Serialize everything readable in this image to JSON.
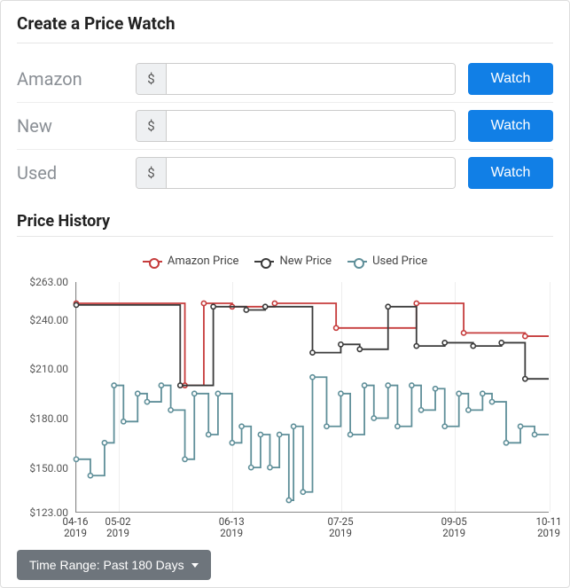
{
  "create_watch": {
    "title": "Create a Price Watch",
    "currency_symbol": "$",
    "rows": [
      {
        "label": "Amazon",
        "button": "Watch",
        "value": ""
      },
      {
        "label": "New",
        "button": "Watch",
        "value": ""
      },
      {
        "label": "Used",
        "button": "Watch",
        "value": ""
      }
    ]
  },
  "history": {
    "title": "Price History",
    "legend": {
      "amazon": "Amazon Price",
      "new": "New Price",
      "used": "Used Price"
    }
  },
  "timerange": {
    "label": "Time Range: Past 180 Days"
  },
  "chart_data": {
    "type": "line",
    "title": "Price History",
    "ylabel": "",
    "xlabel": "",
    "ylim": [
      123,
      263
    ],
    "y_ticks": [
      263.0,
      240.0,
      210.0,
      180.0,
      150.0,
      123.0
    ],
    "x_ticks": [
      {
        "t": 0.0,
        "label_top": "04-16",
        "label_bottom": "2019"
      },
      {
        "t": 0.09,
        "label_top": "05-02",
        "label_bottom": "2019"
      },
      {
        "t": 0.33,
        "label_top": "06-13",
        "label_bottom": "2019"
      },
      {
        "t": 0.56,
        "label_top": "07-25",
        "label_bottom": "2019"
      },
      {
        "t": 0.8,
        "label_top": "09-05",
        "label_bottom": "2019"
      },
      {
        "t": 1.0,
        "label_top": "10-11",
        "label_bottom": "2019"
      }
    ],
    "colors": {
      "amazon": "#c63c3c",
      "new": "#3b3b3b",
      "used": "#5f8f99"
    },
    "series": [
      {
        "name": "Amazon Price",
        "key": "amazon",
        "points": [
          [
            0.0,
            250
          ],
          [
            0.23,
            250
          ],
          [
            0.23,
            200
          ],
          [
            0.27,
            200
          ],
          [
            0.27,
            250
          ],
          [
            0.33,
            250
          ],
          [
            0.33,
            248
          ],
          [
            0.42,
            248
          ],
          [
            0.42,
            250
          ],
          [
            0.55,
            250
          ],
          [
            0.55,
            235
          ],
          [
            0.72,
            235
          ],
          [
            0.72,
            250
          ],
          [
            0.82,
            250
          ],
          [
            0.82,
            232
          ],
          [
            0.95,
            232
          ],
          [
            0.95,
            230
          ],
          [
            1.0,
            230
          ]
        ]
      },
      {
        "name": "New Price",
        "key": "new",
        "points": [
          [
            0.0,
            249
          ],
          [
            0.22,
            249
          ],
          [
            0.22,
            200
          ],
          [
            0.29,
            200
          ],
          [
            0.29,
            248
          ],
          [
            0.36,
            248
          ],
          [
            0.36,
            246
          ],
          [
            0.4,
            246
          ],
          [
            0.4,
            248
          ],
          [
            0.5,
            248
          ],
          [
            0.5,
            220
          ],
          [
            0.56,
            220
          ],
          [
            0.56,
            225
          ],
          [
            0.6,
            225
          ],
          [
            0.6,
            222
          ],
          [
            0.66,
            222
          ],
          [
            0.66,
            248
          ],
          [
            0.72,
            248
          ],
          [
            0.72,
            224
          ],
          [
            0.78,
            224
          ],
          [
            0.78,
            226
          ],
          [
            0.84,
            226
          ],
          [
            0.84,
            224
          ],
          [
            0.9,
            224
          ],
          [
            0.9,
            226
          ],
          [
            0.95,
            226
          ],
          [
            0.95,
            204
          ],
          [
            1.0,
            204
          ]
        ]
      },
      {
        "name": "Used Price",
        "key": "used",
        "points": [
          [
            0.0,
            155
          ],
          [
            0.03,
            155
          ],
          [
            0.03,
            145
          ],
          [
            0.06,
            145
          ],
          [
            0.06,
            165
          ],
          [
            0.08,
            165
          ],
          [
            0.08,
            200
          ],
          [
            0.1,
            200
          ],
          [
            0.1,
            178
          ],
          [
            0.13,
            178
          ],
          [
            0.13,
            195
          ],
          [
            0.15,
            195
          ],
          [
            0.15,
            190
          ],
          [
            0.18,
            190
          ],
          [
            0.18,
            200
          ],
          [
            0.2,
            200
          ],
          [
            0.2,
            185
          ],
          [
            0.23,
            185
          ],
          [
            0.23,
            155
          ],
          [
            0.25,
            155
          ],
          [
            0.25,
            195
          ],
          [
            0.28,
            195
          ],
          [
            0.28,
            170
          ],
          [
            0.3,
            170
          ],
          [
            0.3,
            195
          ],
          [
            0.33,
            195
          ],
          [
            0.33,
            165
          ],
          [
            0.35,
            165
          ],
          [
            0.35,
            175
          ],
          [
            0.37,
            175
          ],
          [
            0.37,
            150
          ],
          [
            0.39,
            150
          ],
          [
            0.39,
            170
          ],
          [
            0.41,
            170
          ],
          [
            0.41,
            150
          ],
          [
            0.43,
            150
          ],
          [
            0.43,
            170
          ],
          [
            0.45,
            170
          ],
          [
            0.45,
            130
          ],
          [
            0.46,
            130
          ],
          [
            0.46,
            175
          ],
          [
            0.48,
            175
          ],
          [
            0.48,
            135
          ],
          [
            0.5,
            135
          ],
          [
            0.5,
            205
          ],
          [
            0.53,
            205
          ],
          [
            0.53,
            175
          ],
          [
            0.56,
            175
          ],
          [
            0.56,
            195
          ],
          [
            0.58,
            195
          ],
          [
            0.58,
            170
          ],
          [
            0.61,
            170
          ],
          [
            0.61,
            200
          ],
          [
            0.63,
            200
          ],
          [
            0.63,
            180
          ],
          [
            0.66,
            180
          ],
          [
            0.66,
            200
          ],
          [
            0.68,
            200
          ],
          [
            0.68,
            175
          ],
          [
            0.71,
            175
          ],
          [
            0.71,
            200
          ],
          [
            0.73,
            200
          ],
          [
            0.73,
            185
          ],
          [
            0.76,
            185
          ],
          [
            0.76,
            198
          ],
          [
            0.78,
            198
          ],
          [
            0.78,
            175
          ],
          [
            0.81,
            175
          ],
          [
            0.81,
            195
          ],
          [
            0.83,
            195
          ],
          [
            0.83,
            185
          ],
          [
            0.86,
            185
          ],
          [
            0.86,
            195
          ],
          [
            0.88,
            195
          ],
          [
            0.88,
            190
          ],
          [
            0.91,
            190
          ],
          [
            0.91,
            165
          ],
          [
            0.94,
            165
          ],
          [
            0.94,
            175
          ],
          [
            0.97,
            175
          ],
          [
            0.97,
            170
          ],
          [
            1.0,
            170
          ]
        ]
      }
    ]
  }
}
